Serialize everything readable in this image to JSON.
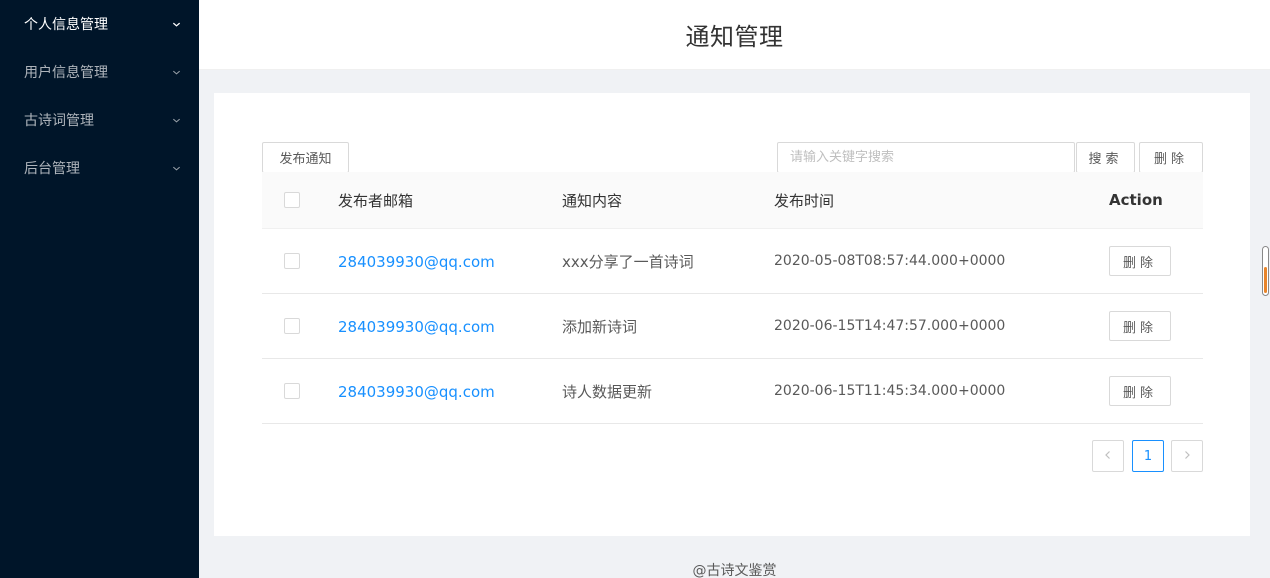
{
  "sidebar": {
    "items": [
      {
        "label": "个人信息管理"
      },
      {
        "label": "用户信息管理"
      },
      {
        "label": "古诗词管理"
      },
      {
        "label": "后台管理"
      }
    ]
  },
  "header": {
    "title": "通知管理"
  },
  "toolbar": {
    "publish_label": "发布通知",
    "search_placeholder": "请输入关键字搜索",
    "search_value": "",
    "search_label": "搜索",
    "delete_label": "删除"
  },
  "table": {
    "columns": [
      "发布者邮箱",
      "通知内容",
      "发布时间",
      "Action"
    ],
    "rows": [
      {
        "email": "284039930@qq.com",
        "content": "xxx分享了一首诗词",
        "time": "2020-05-08T08:57:44.000+0000",
        "action": "删除"
      },
      {
        "email": "284039930@qq.com",
        "content": "添加新诗词",
        "time": "2020-06-15T14:47:57.000+0000",
        "action": "删除"
      },
      {
        "email": "284039930@qq.com",
        "content": "诗人数据更新",
        "time": "2020-06-15T11:45:34.000+0000",
        "action": "删除"
      }
    ]
  },
  "pagination": {
    "current": "1"
  },
  "footer": {
    "text": "@古诗文鉴赏"
  },
  "colors": {
    "sidebar_bg": "#001529",
    "link": "#1890ff",
    "accent": "#1890ff"
  }
}
